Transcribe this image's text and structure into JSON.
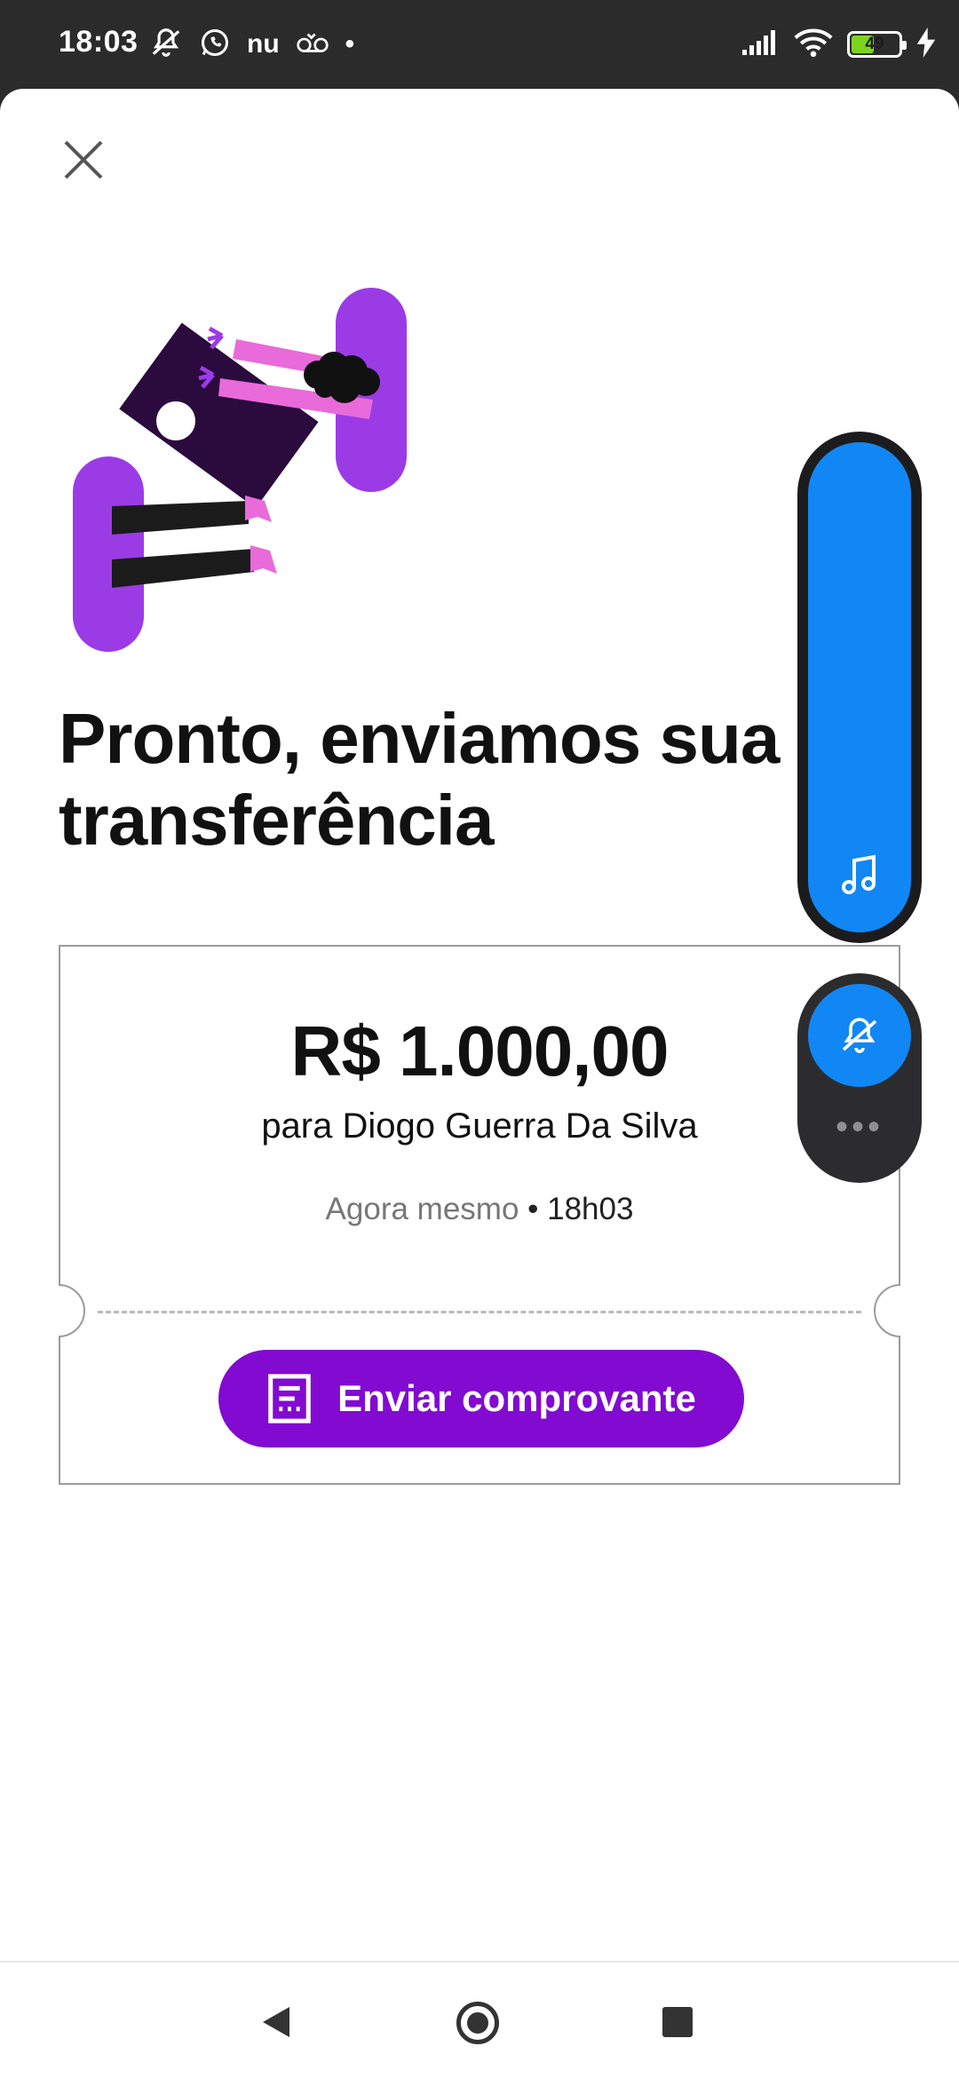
{
  "status_bar": {
    "time": "18:03",
    "carrier_text": "nu",
    "dot": "•",
    "battery_level": 49,
    "battery_text": "49",
    "icons": [
      "mute-icon",
      "whatsapp-icon",
      "nubank-icon",
      "voicemail-icon",
      "signal-icon",
      "wifi-icon",
      "battery-icon",
      "charging-icon"
    ]
  },
  "screen": {
    "close_icon": "close-icon",
    "title": "Pronto, enviamos sua transferência"
  },
  "receipt": {
    "amount": "R$ 1.000,00",
    "recipient": "para Diogo Guerra Da Silva",
    "when": "Agora mesmo",
    "separator": " • ",
    "time": "18h03",
    "send_button_label": "Enviar comprovante",
    "send_button_icon": "receipt-icon"
  },
  "volume_panel": {
    "media_level": 1.0,
    "media_icon": "music-note-icon",
    "ring_icon": "bell-off-icon",
    "more_label": "•••"
  },
  "colors": {
    "accent": "#820ad1",
    "volume_blue": "#1187f5",
    "illustration_purple": "#9b3be6",
    "illustration_dark": "#2b0a3d",
    "illustration_pink": "#e96ad9"
  },
  "nav_bar": {
    "icons": [
      "back-icon",
      "home-icon",
      "recents-icon"
    ]
  }
}
